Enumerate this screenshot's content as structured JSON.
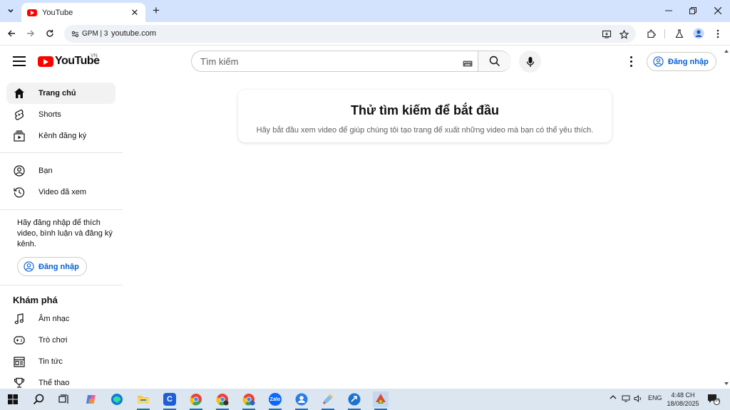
{
  "browser": {
    "tab_title": "YouTube",
    "site_chip": "GPM | 3",
    "url": "youtube.com"
  },
  "youtube": {
    "logo_text": "YouTube",
    "country_code": "VN",
    "search_placeholder": "Tìm kiếm",
    "signin_label": "Đăng nhập"
  },
  "sidebar": {
    "section1": [
      {
        "label": "Trang chủ",
        "icon": "home-icon",
        "active": true
      },
      {
        "label": "Shorts",
        "icon": "shorts-icon"
      },
      {
        "label": "Kênh đăng ký",
        "icon": "subscriptions-icon"
      }
    ],
    "section2": [
      {
        "label": "Bạn",
        "icon": "you-icon"
      },
      {
        "label": "Video đã xem",
        "icon": "history-icon"
      }
    ],
    "signin_prompt": "Hãy đăng nhập để thích video, bình luận và đăng ký kênh.",
    "signin_label": "Đăng nhập",
    "explore_heading": "Khám phá",
    "explore": [
      {
        "label": "Âm nhạc",
        "icon": "music-icon"
      },
      {
        "label": "Trò chơi",
        "icon": "gaming-icon"
      },
      {
        "label": "Tin tức",
        "icon": "news-icon"
      },
      {
        "label": "Thể thao",
        "icon": "sports-icon"
      }
    ]
  },
  "main": {
    "title": "Thử tìm kiếm để bắt đầu",
    "subtitle": "Hãy bắt đầu xem video để giúp chúng tôi tạo trang để xuất những video mà bạn có thể yêu thích."
  },
  "taskbar": {
    "lang": "ENG",
    "time": "4:48 CH",
    "date": "18/08/2025",
    "notification_count": "10",
    "zalo_label": "Zalo"
  }
}
